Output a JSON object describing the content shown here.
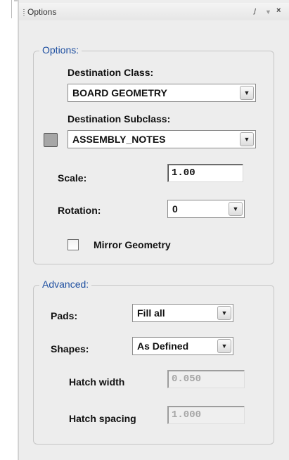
{
  "window": {
    "title": "Options",
    "pin_icon": "pin-icon",
    "menu_icon": "dropdown-icon",
    "close_icon": "close-icon"
  },
  "options_group": {
    "label": "Options:",
    "destination_class_label": "Destination Class:",
    "destination_class_value": "BOARD GEOMETRY",
    "destination_subclass_label": "Destination Subclass:",
    "destination_subclass_value": "ASSEMBLY_NOTES",
    "subclass_color": "#a6a6a6",
    "scale_label": "Scale:",
    "scale_value": "1.00",
    "rotation_label": "Rotation:",
    "rotation_value": "0",
    "mirror_label": "Mirror Geometry",
    "mirror_checked": false
  },
  "advanced_group": {
    "label": "Advanced:",
    "pads_label": "Pads:",
    "pads_value": "Fill all",
    "shapes_label": "Shapes:",
    "shapes_value": "As Defined",
    "hatch_width_label": "Hatch width",
    "hatch_width_value": "0.050",
    "hatch_spacing_label": "Hatch spacing",
    "hatch_spacing_value": "1.000"
  },
  "colors": {
    "group_label": "#1e4fa0",
    "panel_bg": "#ededed"
  }
}
